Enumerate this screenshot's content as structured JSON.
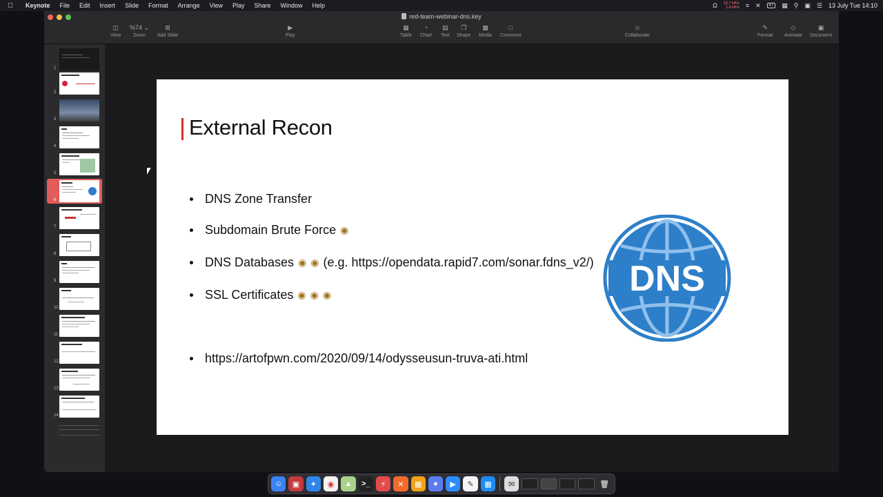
{
  "menubar": {
    "app": "Keynote",
    "items": [
      "File",
      "Edit",
      "Insert",
      "Slide",
      "Format",
      "Arrange",
      "View",
      "Play",
      "Share",
      "Window",
      "Help"
    ],
    "net_up": "16,7 kB/s",
    "net_down": "1,4 kB/s",
    "battery": "47",
    "clock": "13 July Tue  14:10"
  },
  "window": {
    "doc_title": "red-team-webinar-dns.key",
    "toolbar": {
      "view": "View",
      "zoom_value": "%74",
      "zoom": "Zoom",
      "add_slide": "Add Slide",
      "play": "Play",
      "table": "Table",
      "chart": "Chart",
      "text": "Text",
      "shape": "Shape",
      "media": "Media",
      "comment": "Comment",
      "collaborate": "Collaborate",
      "format": "Format",
      "animate": "Animate",
      "document": "Document"
    }
  },
  "navigator": {
    "slides": [
      "1",
      "2",
      "3",
      "4",
      "5",
      "6",
      "7",
      "8",
      "9",
      "10",
      "11",
      "12",
      "13",
      "14"
    ],
    "selected": "6"
  },
  "slide": {
    "title": "External Recon",
    "bullets": [
      "DNS Zone Transfer",
      "Subdomain Brute Force",
      "DNS Databases",
      "(e.g. https://opendata.rapid7.com/sonar.fdns_v2/)",
      "SSL Certificates",
      "https://artofpwn.com/2020/09/14/odysseusun-truva-ati.html"
    ],
    "logo_text": "DNS"
  },
  "colors": {
    "accent": "#d2302e",
    "selected_thumb": "#e25c5c",
    "dns_blue": "#2d7fc9"
  }
}
